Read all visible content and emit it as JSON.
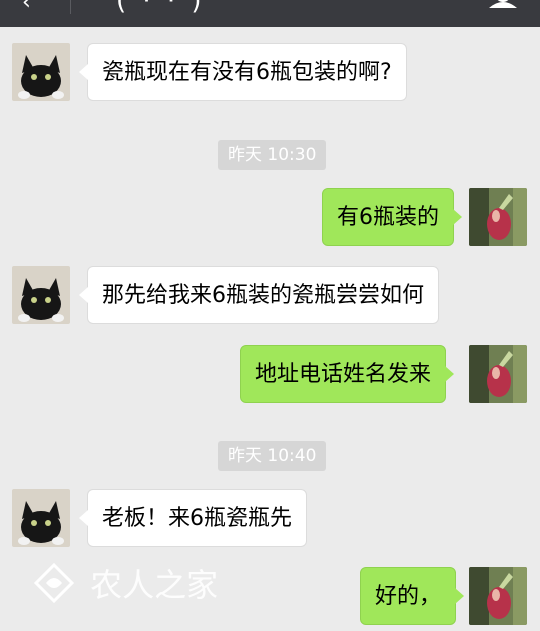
{
  "colors": {
    "header_bg": "#393a3f",
    "chat_bg": "#ebebeb",
    "sent_bubble": "#a0e75a",
    "received_bubble": "#ffffff",
    "timestamp_bg": "#d6d6d6"
  },
  "header": {
    "back_icon": "back-arrow-icon",
    "title": "\"(  ·  ·  )\"",
    "profile_icon": "person-icon"
  },
  "messages": [
    {
      "side": "left",
      "text": "瓷瓶现在有没有6瓶包装的啊?"
    },
    {
      "timestamp": "昨天 10:30"
    },
    {
      "side": "right",
      "text": "有6瓶装的"
    },
    {
      "side": "left",
      "text": "那先给我来6瓶装的瓷瓶尝尝如何"
    },
    {
      "side": "right",
      "text": "地址电话姓名发来"
    },
    {
      "timestamp": "昨天 10:40"
    },
    {
      "side": "left",
      "text": "老板！来6瓶瓷瓶先"
    },
    {
      "side": "right",
      "text": "好的，"
    }
  ],
  "watermark": {
    "text": "农人之家",
    "icon": "farm-logo-icon"
  }
}
